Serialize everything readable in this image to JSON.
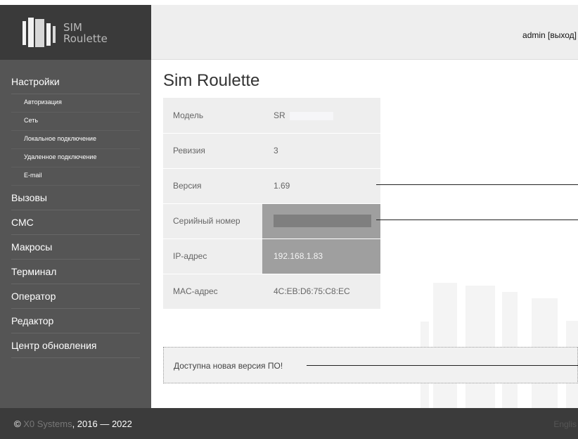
{
  "brand": {
    "line1": "SIM",
    "line2": "Roulette"
  },
  "header": {
    "admin_text": "admin [выход]"
  },
  "page": {
    "title": "Sim Roulette"
  },
  "sidebar": {
    "items": [
      {
        "label": "Настройки"
      },
      {
        "label": "Авторизация"
      },
      {
        "label": "Сеть"
      },
      {
        "label": "Локальное подключение"
      },
      {
        "label": "Удаленное подключение"
      },
      {
        "label": "E-mail"
      },
      {
        "label": "Вызовы"
      },
      {
        "label": "СМС"
      },
      {
        "label": "Макросы"
      },
      {
        "label": "Терминал"
      },
      {
        "label": "Оператор"
      },
      {
        "label": "Редактор"
      },
      {
        "label": "Центр обновления"
      }
    ]
  },
  "info": {
    "rows": [
      {
        "label": "Модель",
        "value": "SR"
      },
      {
        "label": "Ревизия",
        "value": "3"
      },
      {
        "label": "Версия",
        "value": "1.69"
      },
      {
        "label": "Серийный номер",
        "value": ""
      },
      {
        "label": "IP-адрес",
        "value": "192.168.1.83"
      },
      {
        "label": "MAC-адрес",
        "value": "4C:EB:D6:75:C8:EC"
      }
    ]
  },
  "notice": {
    "text": "Доступна новая версия ПО!"
  },
  "footer": {
    "copyright_symbol": "©",
    "company": "X0 Systems",
    "years": ", 2016 — 2022",
    "language": "Englis"
  }
}
